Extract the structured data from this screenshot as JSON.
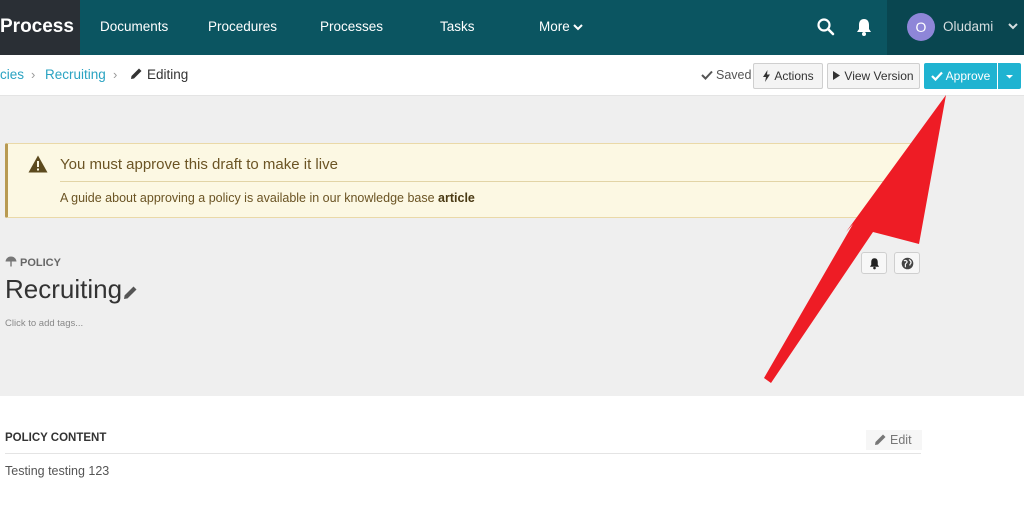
{
  "nav": {
    "brand": "Process",
    "items": [
      {
        "label": "Documents"
      },
      {
        "label": "Procedures"
      },
      {
        "label": "Processes"
      },
      {
        "label": "Tasks"
      },
      {
        "label": "More"
      }
    ],
    "icons": [
      "search-icon",
      "bell-icon"
    ],
    "user": {
      "initial": "O",
      "name": "Oludami"
    }
  },
  "breadcrumb": {
    "items": [
      {
        "label": "cies"
      },
      {
        "label": "Recruiting"
      },
      {
        "label": "Editing"
      }
    ]
  },
  "toolbar": {
    "status": "Saved",
    "actions_label": "Actions",
    "view_version_label": "View Version",
    "approve_label": "Approve"
  },
  "alert": {
    "title": "You must approve this draft to make it live",
    "text": "A guide about approving a policy is available in our knowledge base",
    "link": "article"
  },
  "document": {
    "type": "POLICY",
    "title": "Recruiting",
    "tags_placeholder": "Click to add tags..."
  },
  "content": {
    "heading": "POLICY CONTENT",
    "edit_label": "Edit",
    "body": "Testing testing 123"
  },
  "colors": {
    "nav_bg": "#0b5561",
    "accent": "#1fb3d1",
    "annotation_arrow": "#ee1c25"
  }
}
